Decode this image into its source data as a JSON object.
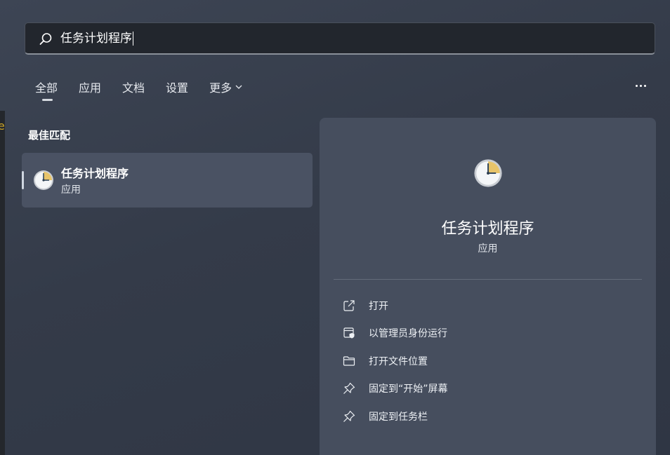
{
  "search": {
    "query": "任务计划程序"
  },
  "tabs": [
    {
      "label": "全部",
      "active": true
    },
    {
      "label": "应用"
    },
    {
      "label": "文档"
    },
    {
      "label": "设置"
    },
    {
      "label": "更多"
    }
  ],
  "best_match": {
    "heading": "最佳匹配",
    "title": "任务计划程序",
    "subtitle": "应用"
  },
  "details": {
    "app_name": "任务计划程序",
    "app_type": "应用",
    "actions": [
      {
        "label": "打开",
        "icon": "open-external-icon"
      },
      {
        "label": "以管理员身份运行",
        "icon": "admin-shield-icon"
      },
      {
        "label": "打开文件位置",
        "icon": "folder-icon"
      },
      {
        "label": "固定到“开始”屏幕",
        "icon": "pin-icon"
      },
      {
        "label": "固定到任务栏",
        "icon": "pin-icon"
      }
    ]
  },
  "colors": {
    "background": "#353c4a",
    "panel": "#464e5e",
    "selected_item": "#4a5263",
    "search_box": "#22262d",
    "clock_accent": "#e8c46a"
  }
}
